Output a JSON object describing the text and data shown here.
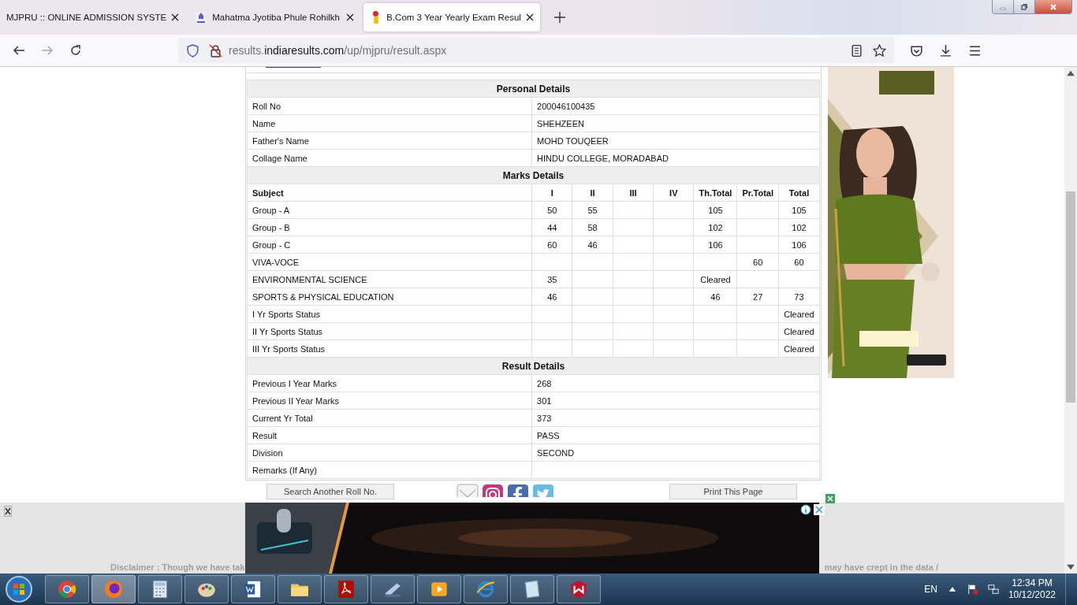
{
  "browser": {
    "tabs": [
      {
        "title": "MJPRU :: ONLINE ADMISSION SYSTE",
        "selected": false
      },
      {
        "title": "Mahatma Jyotiba Phule Rohilkh",
        "selected": false
      },
      {
        "title": "B.Com 3 Year Yearly Exam Resul",
        "selected": true
      }
    ],
    "url": {
      "prefix": "results.",
      "domain": "indiaresults.com",
      "path": "/up/mjpru/result.aspx"
    }
  },
  "personal": {
    "title": "Personal Details",
    "rows": [
      {
        "label": "Roll No",
        "value": "200046100435"
      },
      {
        "label": "Name",
        "value": "SHEHZEEN"
      },
      {
        "label": "Father's Name",
        "value": "MOHD TOUQEER"
      },
      {
        "label": "Collage Name",
        "value": "HINDU COLLEGE, MORADABAD"
      }
    ]
  },
  "marks": {
    "title": "Marks Details",
    "columns": [
      "Subject",
      "I",
      "II",
      "III",
      "IV",
      "Th.Total",
      "Pr.Total",
      "Total"
    ],
    "rows": [
      [
        "Group - A",
        "50",
        "55",
        null,
        null,
        "105",
        null,
        "105"
      ],
      [
        "Group - B",
        "44",
        "58",
        null,
        null,
        "102",
        null,
        "102"
      ],
      [
        "Group - C",
        "60",
        "46",
        null,
        null,
        "106",
        null,
        "106"
      ],
      [
        "VIVA-VOCE",
        null,
        null,
        null,
        null,
        null,
        "60",
        "60"
      ],
      [
        "ENVIRONMENTAL SCIENCE",
        "35",
        null,
        null,
        null,
        "Cleared",
        null,
        null
      ],
      [
        "SPORTS & PHYSICAL EDUCATION",
        "46",
        null,
        null,
        null,
        "46",
        "27",
        "73"
      ],
      [
        "I Yr Sports Status",
        null,
        null,
        null,
        null,
        null,
        null,
        "Cleared"
      ],
      [
        "II Yr Sports Status",
        null,
        null,
        null,
        null,
        null,
        null,
        "Cleared"
      ],
      [
        "III Yr Sports Status",
        null,
        null,
        null,
        null,
        null,
        null,
        "Cleared"
      ]
    ]
  },
  "result": {
    "title": "Result Details",
    "rows": [
      {
        "label": "Previous I Year Marks",
        "value": "268"
      },
      {
        "label": "Previous II Year Marks",
        "value": "301"
      },
      {
        "label": "Current Yr Total",
        "value": "373"
      },
      {
        "label": "Result",
        "value": "PASS"
      },
      {
        "label": "Division",
        "value": "SECOND"
      },
      {
        "label": "Remarks (If Any)",
        "value": null
      }
    ]
  },
  "actions": {
    "search_button": "Search Another Roll No.",
    "print_button": "Print This Page"
  },
  "disclaimer": {
    "left": "Disclaimer : Though we have tak",
    "right": "may have crept in the data /"
  },
  "taskbar": {
    "language": "EN",
    "time": "12:34 PM",
    "date": "10/12/2022"
  }
}
